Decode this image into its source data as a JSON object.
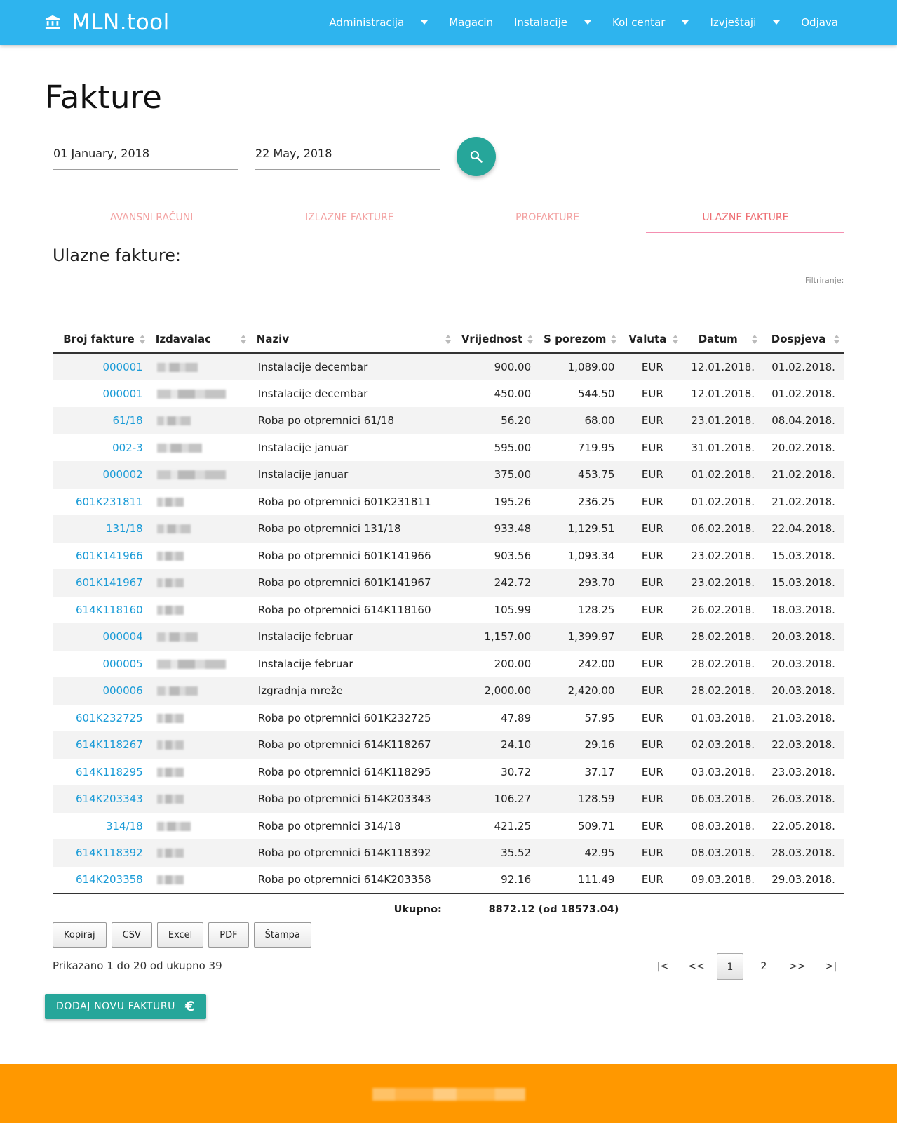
{
  "nav": {
    "brand": "MLN.tool",
    "items": [
      {
        "label": "Administracija",
        "dropdown": true
      },
      {
        "label": "Magacin",
        "dropdown": false
      },
      {
        "label": "Instalacije",
        "dropdown": true
      },
      {
        "label": "Kol centar",
        "dropdown": true
      },
      {
        "label": "Izvještaji",
        "dropdown": true
      },
      {
        "label": "Odjava",
        "dropdown": false
      }
    ]
  },
  "page": {
    "title": "Fakture",
    "date_from": "01 January, 2018",
    "date_to": "22 May, 2018"
  },
  "tabs": [
    {
      "label": "AVANSNI RAČUNI",
      "active": false
    },
    {
      "label": "IZLAZNE FAKTURE",
      "active": false
    },
    {
      "label": "PROFAKTURE",
      "active": false
    },
    {
      "label": "ULAZNE FAKTURE",
      "active": true
    }
  ],
  "section": {
    "title": "Ulazne fakture:",
    "filter_label": "Filtriranje:"
  },
  "table": {
    "columns": [
      "Broj fakture",
      "Izdavalac",
      "Naziv",
      "Vrijednost",
      "S porezom",
      "Valuta",
      "Datum",
      "Dospjeva"
    ],
    "rows": [
      {
        "broj": "000001",
        "naziv": "Instalacije decembar",
        "vrijednost": "900.00",
        "s_porezom": "1,089.00",
        "valuta": "EUR",
        "datum": "12.01.2018.",
        "dospjeva": "01.02.2018."
      },
      {
        "broj": "000001",
        "naziv": "Instalacije decembar",
        "vrijednost": "450.00",
        "s_porezom": "544.50",
        "valuta": "EUR",
        "datum": "12.01.2018.",
        "dospjeva": "01.02.2018."
      },
      {
        "broj": "61/18",
        "naziv": "Roba po otpremnici 61/18",
        "vrijednost": "56.20",
        "s_porezom": "68.00",
        "valuta": "EUR",
        "datum": "23.01.2018.",
        "dospjeva": "08.04.2018."
      },
      {
        "broj": "002-3",
        "naziv": "Instalacije januar",
        "vrijednost": "595.00",
        "s_porezom": "719.95",
        "valuta": "EUR",
        "datum": "31.01.2018.",
        "dospjeva": "20.02.2018."
      },
      {
        "broj": "000002",
        "naziv": "Instalacije januar",
        "vrijednost": "375.00",
        "s_porezom": "453.75",
        "valuta": "EUR",
        "datum": "01.02.2018.",
        "dospjeva": "21.02.2018."
      },
      {
        "broj": "601K231811",
        "naziv": "Roba po otpremnici 601K231811",
        "vrijednost": "195.26",
        "s_porezom": "236.25",
        "valuta": "EUR",
        "datum": "01.02.2018.",
        "dospjeva": "21.02.2018."
      },
      {
        "broj": "131/18",
        "naziv": "Roba po otpremnici 131/18",
        "vrijednost": "933.48",
        "s_porezom": "1,129.51",
        "valuta": "EUR",
        "datum": "06.02.2018.",
        "dospjeva": "22.04.2018."
      },
      {
        "broj": "601K141966",
        "naziv": "Roba po otpremnici 601K141966",
        "vrijednost": "903.56",
        "s_porezom": "1,093.34",
        "valuta": "EUR",
        "datum": "23.02.2018.",
        "dospjeva": "15.03.2018."
      },
      {
        "broj": "601K141967",
        "naziv": "Roba po otpremnici 601K141967",
        "vrijednost": "242.72",
        "s_porezom": "293.70",
        "valuta": "EUR",
        "datum": "23.02.2018.",
        "dospjeva": "15.03.2018."
      },
      {
        "broj": "614K118160",
        "naziv": "Roba po otpremnici 614K118160",
        "vrijednost": "105.99",
        "s_porezom": "128.25",
        "valuta": "EUR",
        "datum": "26.02.2018.",
        "dospjeva": "18.03.2018."
      },
      {
        "broj": "000004",
        "naziv": "Instalacije februar",
        "vrijednost": "1,157.00",
        "s_porezom": "1,399.97",
        "valuta": "EUR",
        "datum": "28.02.2018.",
        "dospjeva": "20.03.2018."
      },
      {
        "broj": "000005",
        "naziv": "Instalacije februar",
        "vrijednost": "200.00",
        "s_porezom": "242.00",
        "valuta": "EUR",
        "datum": "28.02.2018.",
        "dospjeva": "20.03.2018."
      },
      {
        "broj": "000006",
        "naziv": "Izgradnja mreže",
        "vrijednost": "2,000.00",
        "s_porezom": "2,420.00",
        "valuta": "EUR",
        "datum": "28.02.2018.",
        "dospjeva": "20.03.2018."
      },
      {
        "broj": "601K232725",
        "naziv": "Roba po otpremnici 601K232725",
        "vrijednost": "47.89",
        "s_porezom": "57.95",
        "valuta": "EUR",
        "datum": "01.03.2018.",
        "dospjeva": "21.03.2018."
      },
      {
        "broj": "614K118267",
        "naziv": "Roba po otpremnici 614K118267",
        "vrijednost": "24.10",
        "s_porezom": "29.16",
        "valuta": "EUR",
        "datum": "02.03.2018.",
        "dospjeva": "22.03.2018."
      },
      {
        "broj": "614K118295",
        "naziv": "Roba po otpremnici 614K118295",
        "vrijednost": "30.72",
        "s_porezom": "37.17",
        "valuta": "EUR",
        "datum": "03.03.2018.",
        "dospjeva": "23.03.2018."
      },
      {
        "broj": "614K203343",
        "naziv": "Roba po otpremnici 614K203343",
        "vrijednost": "106.27",
        "s_porezom": "128.59",
        "valuta": "EUR",
        "datum": "06.03.2018.",
        "dospjeva": "26.03.2018."
      },
      {
        "broj": "314/18",
        "naziv": "Roba po otpremnici 314/18",
        "vrijednost": "421.25",
        "s_porezom": "509.71",
        "valuta": "EUR",
        "datum": "08.03.2018.",
        "dospjeva": "22.05.2018."
      },
      {
        "broj": "614K118392",
        "naziv": "Roba po otpremnici 614K118392",
        "vrijednost": "35.52",
        "s_porezom": "42.95",
        "valuta": "EUR",
        "datum": "08.03.2018.",
        "dospjeva": "28.03.2018."
      },
      {
        "broj": "614K203358",
        "naziv": "Roba po otpremnici 614K203358",
        "vrijednost": "92.16",
        "s_porezom": "111.49",
        "valuta": "EUR",
        "datum": "09.03.2018.",
        "dospjeva": "29.03.2018."
      }
    ],
    "total_label": "Ukupno:",
    "total_value": "8872.12 (od 18573.04)"
  },
  "export_buttons": [
    "Kopiraj",
    "CSV",
    "Excel",
    "PDF",
    "Štampa"
  ],
  "info": "Prikazano 1 do 20 od ukupno 39",
  "pagination": [
    {
      "label": "|<",
      "current": false
    },
    {
      "label": "<<",
      "current": false
    },
    {
      "label": "1",
      "current": true
    },
    {
      "label": "2",
      "current": false
    },
    {
      "label": ">>",
      "current": false
    },
    {
      "label": ">|",
      "current": false
    }
  ],
  "add_button": {
    "label": "DODAJ NOVU FAKTURU",
    "icon": "euro-icon",
    "icon_glyph": "€"
  },
  "colors": {
    "navbar": "#2eb4ee",
    "accent": "#26a69a",
    "link": "#1a9bd7",
    "tab_active": "#ee6e73",
    "tab_inactive": "#f3a2a2",
    "footer": "#ff9800"
  }
}
